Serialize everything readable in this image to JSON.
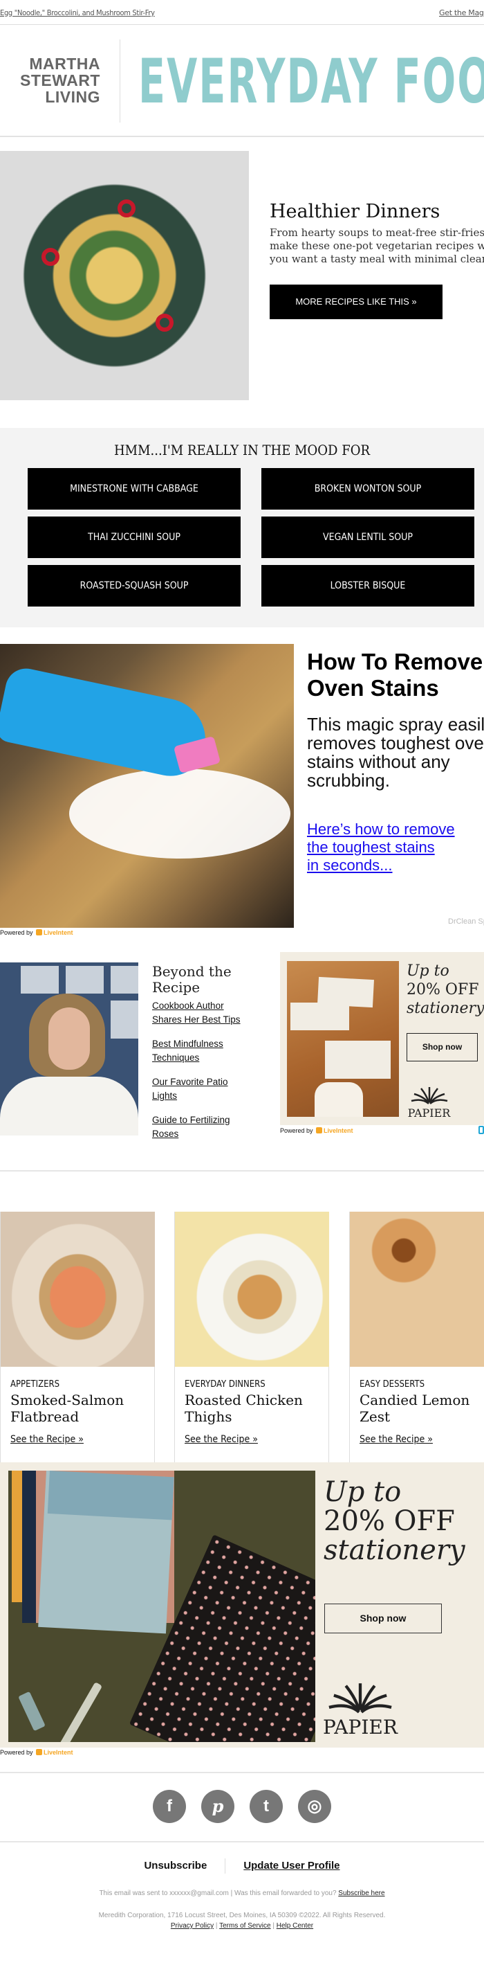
{
  "topbar": {
    "left_link": "Egg \"Noodle,\" Broccolini, and Mushroom Stir-Fry",
    "right_link": "Get the Magazine"
  },
  "masthead": {
    "brand_lines": [
      "MARTHA",
      "STEWART",
      "LIVING"
    ],
    "title": "EVERYDAY FOOD",
    "accent_color": "#8fcccd"
  },
  "hero": {
    "image_alt": "Egg noodle, broccolini and mushroom stir-fry in a bowl",
    "title": "Healthier Dinners",
    "body_lines": [
      "From hearty soups to meat-free stir-fries,",
      "make these one-pot vegetarian recipes when",
      "you want a tasty meal with minimal cleanup."
    ],
    "button_label": "MORE RECIPES LIKE THIS »"
  },
  "mood": {
    "heading": "HMM...I'M REALLY IN THE MOOD FOR",
    "buttons": [
      "MINESTRONE WITH CABBAGE",
      "BROKEN WONTON SOUP",
      "THAI ZUCCHINI SOUP",
      "VEGAN LENTIL SOUP",
      "ROASTED-SQUASH SOUP",
      "LOBSTER BISQUE"
    ]
  },
  "oven_ad": {
    "title_lines": [
      "How To Remove",
      "Oven Stains"
    ],
    "body_lines": [
      "This magic spray easily",
      "removes toughest oven",
      "stains without any",
      "scrubbing."
    ],
    "link_lines": [
      "Here’s how to remove",
      "the toughest stains",
      "in seconds..."
    ],
    "sponsor": "DrClean Spray",
    "powered_by": "Powered by",
    "powered_brand": "LiveIntent"
  },
  "beyond": {
    "title_lines": [
      "Beyond the",
      "Recipe"
    ],
    "links": [
      [
        "Cookbook Author",
        "Shares Her Best Tips"
      ],
      [
        "Best Mindfulness",
        "Techniques"
      ],
      [
        "Our Favorite Patio",
        "Lights"
      ],
      [
        "Guide to Fertilizing",
        "Roses"
      ]
    ]
  },
  "papier_small": {
    "offer_lines": [
      "Up to",
      "20% OFF",
      "stationery"
    ],
    "button_label": "Shop now",
    "brand": "PAPIER",
    "powered_by": "Powered by",
    "powered_brand": "LiveIntent"
  },
  "recipes": [
    {
      "category": "APPETIZERS",
      "name_lines": [
        "Smoked-Salmon",
        "Flatbread"
      ],
      "link": "See the Recipe »"
    },
    {
      "category": "EVERYDAY DINNERS",
      "name_lines": [
        "Roasted Chicken",
        "Thighs"
      ],
      "link": "See the Recipe »"
    },
    {
      "category": "EASY DESSERTS",
      "name_lines": [
        "Candied Lemon",
        "Zest"
      ],
      "link": "See the Recipe »"
    }
  ],
  "papier_big": {
    "offer_lines": [
      "Up to",
      "20% OFF",
      "stationery"
    ],
    "button_label": "Shop now",
    "brand": "PAPIER",
    "powered_by": "Powered by",
    "powered_brand": "LiveIntent"
  },
  "social": {
    "icons": [
      {
        "name": "facebook",
        "glyph": "f"
      },
      {
        "name": "pinterest",
        "glyph": "p"
      },
      {
        "name": "twitter",
        "glyph": "t"
      },
      {
        "name": "instagram",
        "glyph": "◎"
      }
    ]
  },
  "footer": {
    "unsubscribe": "Unsubscribe",
    "update_profile": "Update User Profile",
    "sent_to": "This email was sent to xxxxxx@gmail.com  |  Was this email forwarded to you?",
    "subscribe_here": "Subscribe here",
    "address": "Meredith Corporation, 1716 Locust Street, Des Moines, IA 50309 ©2022. All Rights Reserved.",
    "privacy": "Privacy Policy",
    "terms": "Terms of Service",
    "help": "Help Center",
    "pipe": "|"
  }
}
